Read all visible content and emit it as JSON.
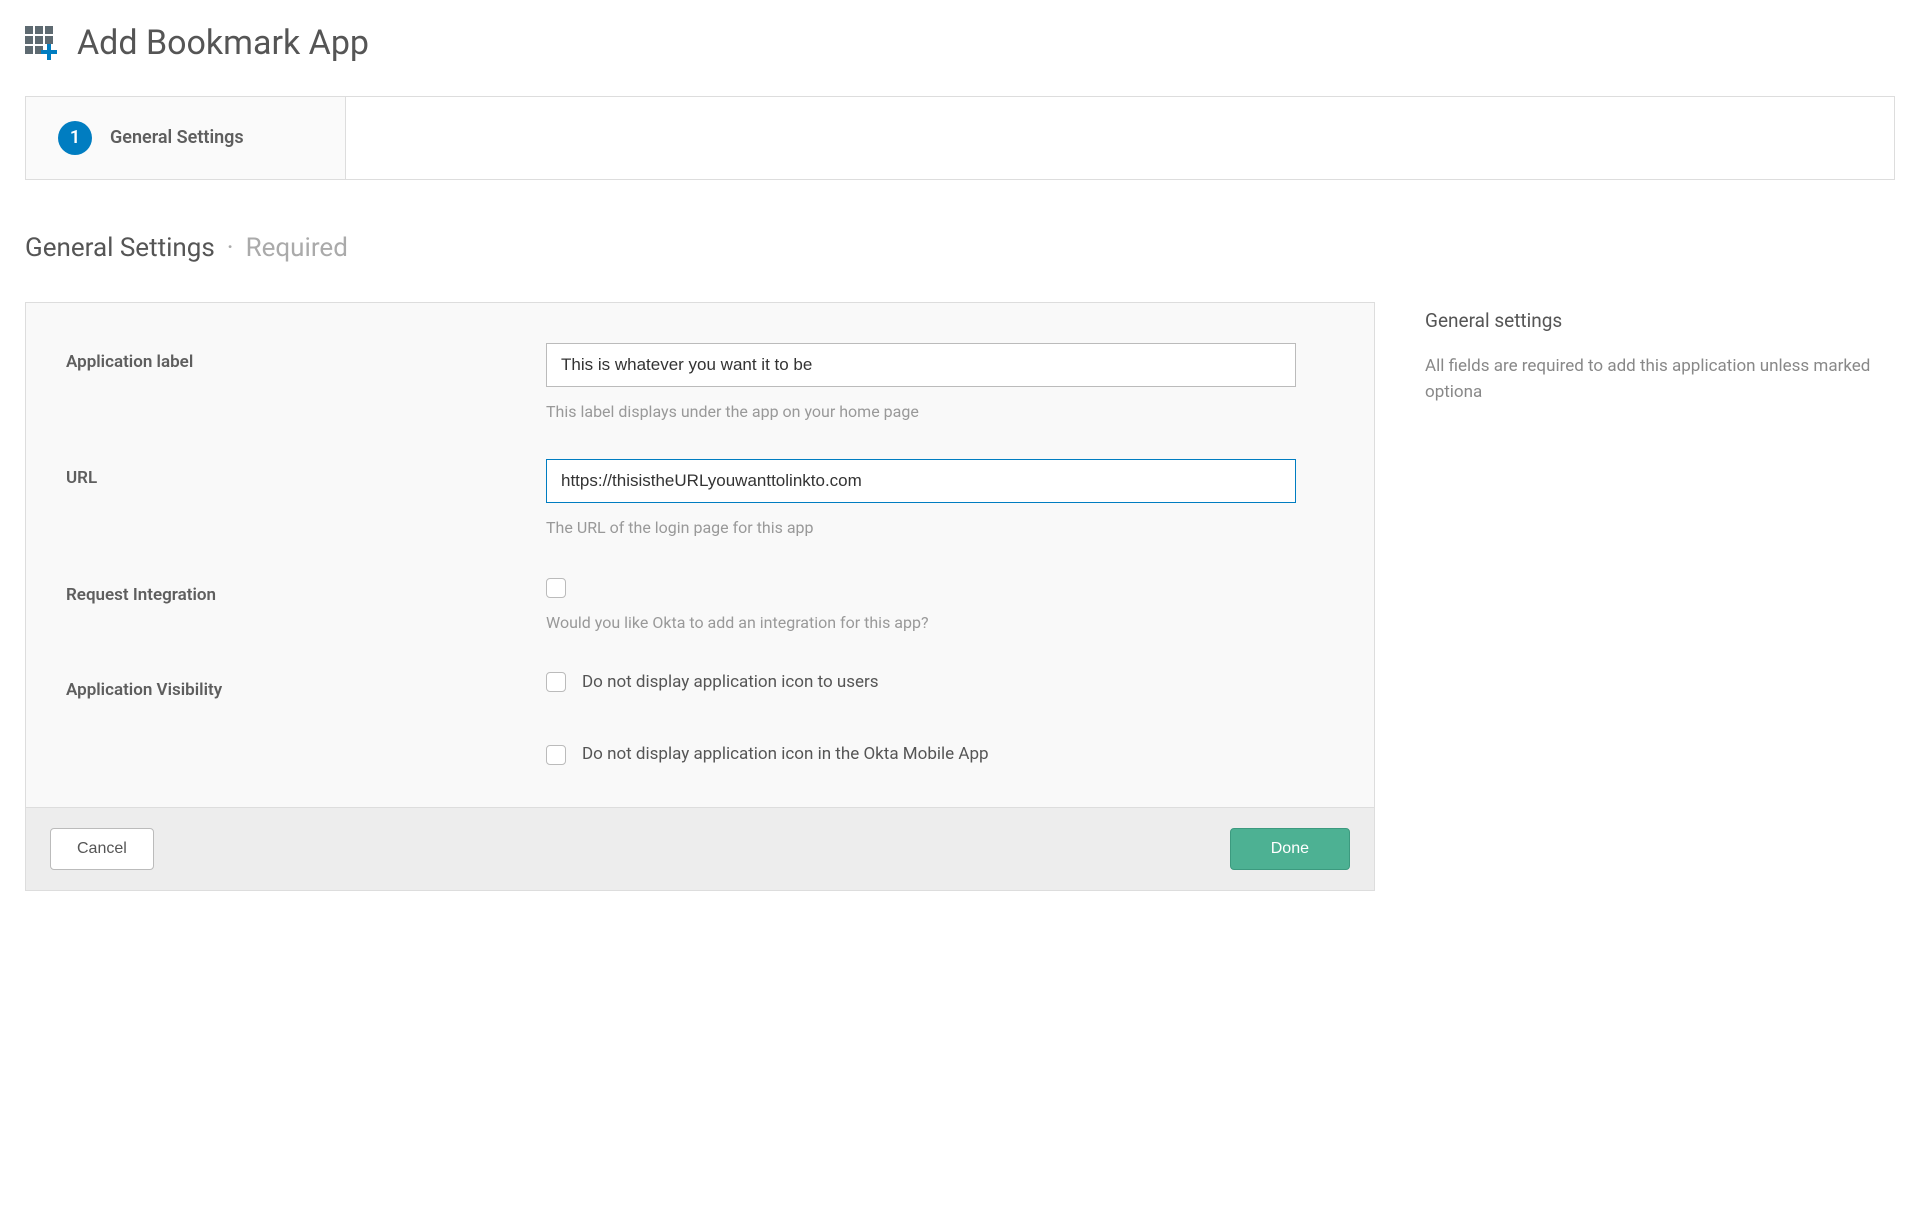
{
  "header": {
    "title": "Add Bookmark App"
  },
  "step": {
    "number": "1",
    "label": "General Settings"
  },
  "section": {
    "title": "General Settings",
    "suffix": "Required"
  },
  "form": {
    "app_label": {
      "label": "Application label",
      "value": "This is whatever you want it to be",
      "help": "This label displays under the app on your home page"
    },
    "url": {
      "label": "URL",
      "value": "https://thisistheURLyouwanttolinkto.com",
      "help": "The URL of the login page for this app"
    },
    "request_integration": {
      "label": "Request Integration",
      "help": "Would you like Okta to add an integration for this app?"
    },
    "visibility": {
      "label": "Application Visibility",
      "option1": "Do not display application icon to users",
      "option2": "Do not display application icon in the Okta Mobile App"
    },
    "buttons": {
      "cancel": "Cancel",
      "done": "Done"
    }
  },
  "sidebar": {
    "heading": "General settings",
    "text": "All fields are required to add this application unless marked optiona"
  }
}
